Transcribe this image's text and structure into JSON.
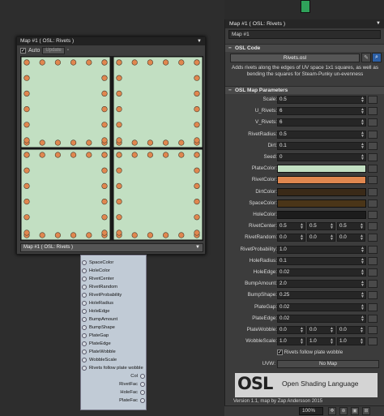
{
  "preview": {
    "title": "Map #1  ( OSL: Rivets )",
    "auto_label": "Auto",
    "update_label": "Update",
    "dropdown_value": "Map #1  ( OSL: Rivets )"
  },
  "node_list": {
    "inputs": [
      "SpaceColor",
      "HoleColor",
      "RivetCenter",
      "RivetRandom",
      "RivetProbability",
      "HoleRadius",
      "HoleEdge",
      "BumpAmount",
      "BumpShape",
      "PlateGap",
      "PlateEdge",
      "PlateWobble",
      "WobbleScale",
      "Rivets follow plate wobble"
    ],
    "outputs": [
      "Col",
      "RivetFac",
      "HoleFac",
      "PlateFac"
    ]
  },
  "panel": {
    "title": "Map #1  ( OSL: Rivets )",
    "map_name": "Map #1",
    "osl_code_header": "OSL Code",
    "osl_file": "Rivets.osl",
    "description": "Adds rivets along the edges of UV space 1x1 squares, as well as bending the squares for Steam-Punky un-evenness",
    "params_header": "OSL Map Parameters",
    "scale_label": "Scale:",
    "scale": "0.5",
    "u_rivets_label": "U_Rivets:",
    "u_rivets": "6",
    "v_rivets_label": "V_Rivets:",
    "v_rivets": "6",
    "rivet_radius_label": "RivetRadius:",
    "rivet_radius": "0.5",
    "dirt_label": "Dirt:",
    "dirt": "0.1",
    "seed_label": "Seed:",
    "seed": "0",
    "plate_color_label": "PlateColor:",
    "rivet_color_label": "RivetColor:",
    "dirt_color_label": "DirtColor:",
    "space_color_label": "SpaceColor:",
    "hole_color_label": "HoleColor:",
    "rivet_center_label": "RivetCenter:",
    "rivet_center": [
      "0.5",
      "0.5",
      "0.5"
    ],
    "rivet_random_label": "RivetRandom:",
    "rivet_random": [
      "0.0",
      "0.0",
      "0.0"
    ],
    "rivet_probability_label": "RivetProbability:",
    "rivet_probability": "1.0",
    "hole_radius_label": "HoleRadius:",
    "hole_radius": "0.1",
    "hole_edge_label": "HoleEdge:",
    "hole_edge": "0.02",
    "bump_amount_label": "BumpAmount:",
    "bump_amount": "2.0",
    "bump_shape_label": "BumpShape:",
    "bump_shape": "0.25",
    "plate_gap_label": "PlateGap:",
    "plate_gap": "0.02",
    "plate_edge_label": "PlateEdge:",
    "plate_edge": "0.02",
    "plate_wobble_label": "PlateWobble:",
    "plate_wobble": [
      "0.0",
      "0.0",
      "0.0"
    ],
    "wobble_scale_label": "WobbleScale:",
    "wobble_scale": [
      "1.0",
      "1.0",
      "1.0"
    ],
    "rivets_follow_label": "Rivets follow plate wobble",
    "uvw_label": "UVW:",
    "uvw_value": "No Map",
    "osl_logo": "OSL",
    "osl_logo_sub": "Open Shading Language",
    "footer": "Version 1.1, map by Zap Andersson 2015"
  },
  "colors": {
    "plate": "#c2dfc2",
    "rivet": "#e0874f",
    "dirt": "#3a2a18",
    "space": "#4a3518",
    "hole": "#1c1c1c"
  },
  "statusbar": {
    "zoom": "100%"
  }
}
